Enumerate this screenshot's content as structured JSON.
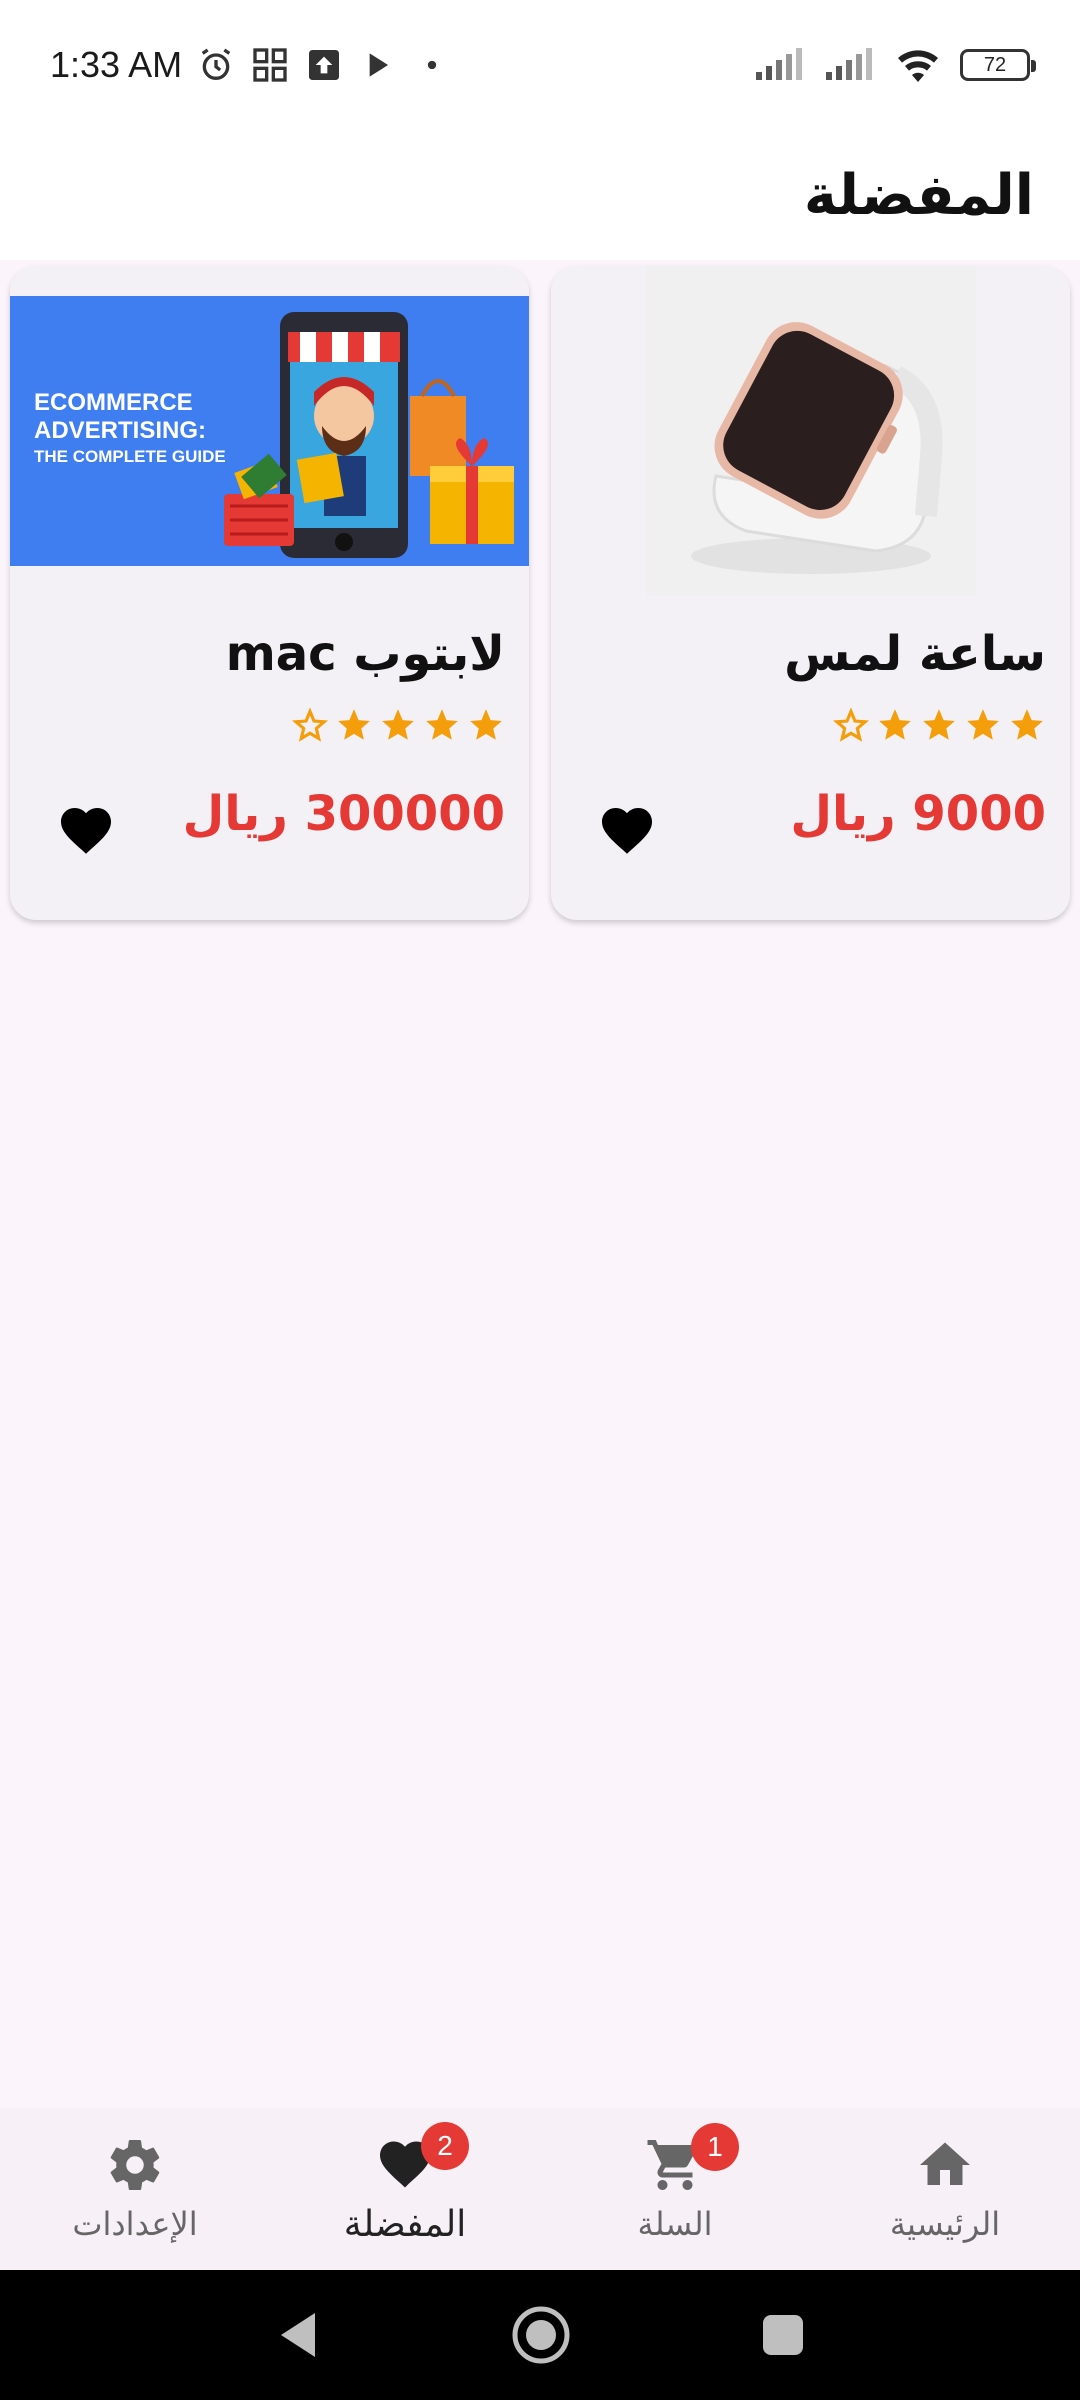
{
  "status_bar": {
    "time": "1:33 AM",
    "battery": "72",
    "icons": [
      "alarm-icon",
      "apps-grid-icon",
      "upload-icon",
      "play-icon",
      "dot-icon",
      "signal-icon",
      "signal-icon",
      "wifi-icon",
      "battery-icon"
    ]
  },
  "header": {
    "title": "المفضلة"
  },
  "products": [
    {
      "title": "ساعة لمس",
      "price": "9000 ريال",
      "rating": 4,
      "max_rating": 5,
      "image": "smartwatch-image",
      "favorite": true
    },
    {
      "title": "لابتوب mac",
      "price": "300000 ريال",
      "rating": 4,
      "max_rating": 5,
      "image": "ecommerce-advertising-image",
      "image_text": [
        "ECOMMERCE",
        "ADVERTISING:",
        "THE COMPLETE GUIDE"
      ],
      "favorite": true
    }
  ],
  "bottom_nav": {
    "items": [
      {
        "label": "الرئيسية",
        "icon": "home-icon",
        "active": false
      },
      {
        "label": "السلة",
        "icon": "cart-icon",
        "badge": "1",
        "active": false
      },
      {
        "label": "المفضلة",
        "icon": "heart-icon",
        "badge": "2",
        "active": true
      },
      {
        "label": "الإعدادات",
        "icon": "gear-icon",
        "active": false
      }
    ]
  },
  "colors": {
    "accent": "#e53935",
    "star": "#f59e0b",
    "background": "#fbf5fb",
    "card": "#f4f1f6"
  }
}
